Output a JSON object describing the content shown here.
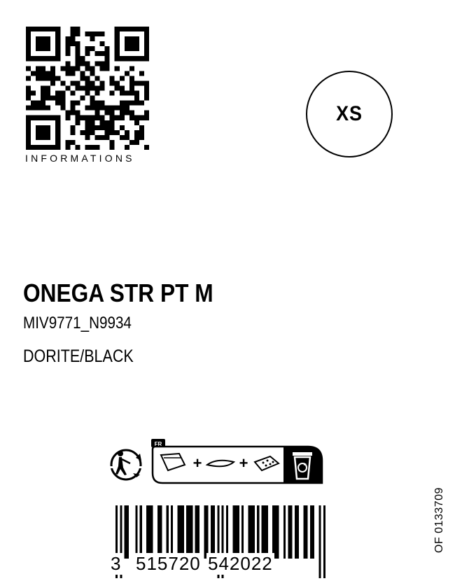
{
  "qr": {
    "caption": "INFORMATIONS"
  },
  "size": {
    "label": "XS"
  },
  "product": {
    "name": "ONEGA STR PT M",
    "reference": "MIV9771_N9934",
    "color": "DORITE/BLACK"
  },
  "recycling": {
    "country": "FR",
    "plus_sign": "+"
  },
  "barcode": {
    "first_digit": "3",
    "left_group": "515720",
    "right_group": "542022"
  },
  "side_code": "OF 0133709"
}
